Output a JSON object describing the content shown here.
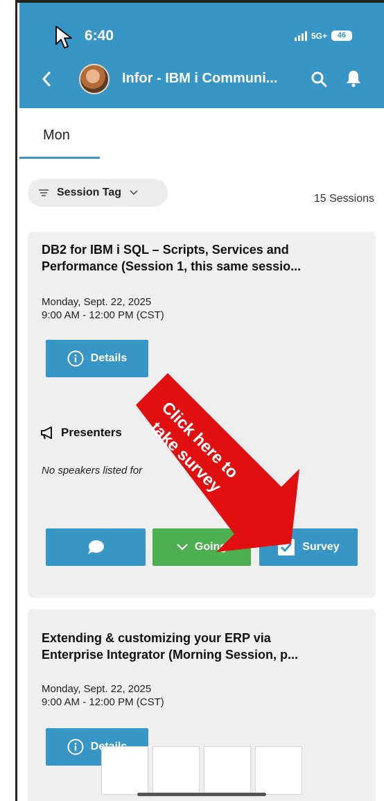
{
  "status_bar": {
    "time": "6:40",
    "network": "5G+",
    "battery": "46"
  },
  "header": {
    "title": "Infor - IBM i Communi..."
  },
  "tabs": {
    "day": "Mon"
  },
  "filter": {
    "label": "Session Tag",
    "count": "15 Sessions"
  },
  "sessions": [
    {
      "title_line1": "DB2 for IBM i SQL – Scripts, Services and",
      "title_line2": "Performance (Session 1,  this same sessio...",
      "date": "Monday, Sept. 22, 2025",
      "time": "9:00 AM - 12:00 PM (CST)",
      "details_label": "Details",
      "presenters_label": "Presenters",
      "no_speakers": "No speakers listed for",
      "going_label": "Going",
      "survey_label": "Survey"
    },
    {
      "title_line1": "Extending & customizing your ERP via",
      "title_line2": "Enterprise Integrator  (Morning Session, p...",
      "date": "Monday, Sept. 22, 2025",
      "time": "9:00 AM - 12:00 PM (CST)",
      "details_label": "Details"
    }
  ],
  "annotation": {
    "line1": "Click here to",
    "line2": "take survey"
  },
  "colors": {
    "header": "#3796c5",
    "going": "#4caf50",
    "arrow": "#e10f0f"
  }
}
